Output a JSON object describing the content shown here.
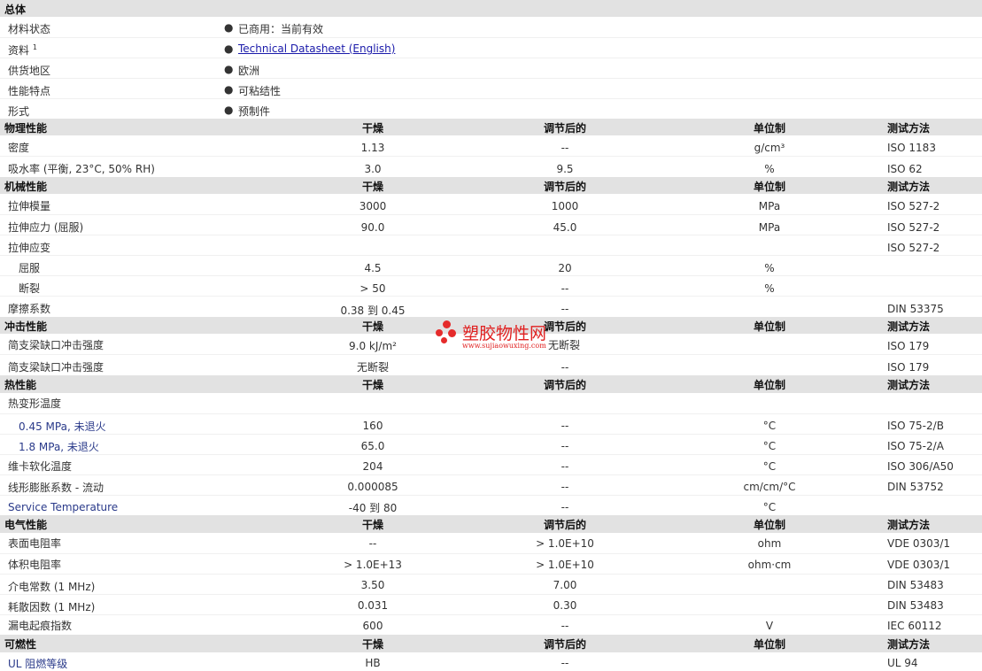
{
  "general": {
    "title": "总体",
    "rows": [
      {
        "label": "材料状态",
        "value": "已商用：当前有效"
      },
      {
        "label": "资料",
        "sup": "1",
        "value": "Technical Datasheet (English)"
      },
      {
        "label": "供货地区",
        "value": "欧洲"
      },
      {
        "label": "性能特点",
        "value": "可粘结性"
      },
      {
        "label": "形式",
        "value": "预制件"
      }
    ]
  },
  "columns": {
    "dry": "干燥",
    "cond": "调节后的",
    "unit": "单位制",
    "method": "测试方法"
  },
  "physical": {
    "title": "物理性能",
    "rows": [
      {
        "label": "密度",
        "dry": "1.13",
        "cond": "--",
        "unit": "g/cm³",
        "method": "ISO 1183"
      },
      {
        "label": "吸水率 (平衡, 23°C, 50% RH)",
        "dry": "3.0",
        "cond": "9.5",
        "unit": "%",
        "method": "ISO 62"
      }
    ]
  },
  "mechanical": {
    "title": "机械性能",
    "rows": [
      {
        "label": "拉伸模量",
        "dry": "3000",
        "cond": "1000",
        "unit": "MPa",
        "method": "ISO 527-2"
      },
      {
        "label": "拉伸应力 (屈服)",
        "dry": "90.0",
        "cond": "45.0",
        "unit": "MPa",
        "method": "ISO 527-2"
      },
      {
        "label": "拉伸应变",
        "dry": "",
        "cond": "",
        "unit": "",
        "method": "ISO 527-2"
      },
      {
        "label": "屈服",
        "dry": "4.5",
        "cond": "20",
        "unit": "%",
        "method": ""
      },
      {
        "label": "断裂",
        "dry": "> 50",
        "cond": "--",
        "unit": "%",
        "method": ""
      },
      {
        "label": "摩擦系数",
        "dry": "0.38 到  0.45",
        "cond": "--",
        "unit": "",
        "method": "DIN 53375"
      }
    ]
  },
  "impact": {
    "title": "冲击性能",
    "rows": [
      {
        "label": "简支梁缺口冲击强度",
        "dry": "9.0 kJ/m²",
        "cond": "无断裂",
        "unit": "",
        "method": "ISO 179"
      },
      {
        "label": "简支梁缺口冲击强度",
        "dry": "无断裂",
        "cond": "--",
        "unit": "",
        "method": "ISO 179"
      }
    ]
  },
  "thermal": {
    "title": "热性能",
    "rows": [
      {
        "label": "热变形温度",
        "dry": "",
        "cond": "",
        "unit": "",
        "method": ""
      },
      {
        "label": "0.45 MPa, 未退火",
        "dry": "160",
        "cond": "--",
        "unit": "°C",
        "method": "ISO 75-2/B"
      },
      {
        "label": "1.8 MPa, 未退火",
        "dry": "65.0",
        "cond": "--",
        "unit": "°C",
        "method": "ISO 75-2/A"
      },
      {
        "label": "维卡软化温度",
        "dry": "204",
        "cond": "--",
        "unit": "°C",
        "method": "ISO 306/A50"
      },
      {
        "label": "线形膨胀系数  - 流动",
        "dry": "0.000085",
        "cond": "--",
        "unit": "cm/cm/°C",
        "method": "DIN 53752"
      },
      {
        "label": "Service Temperature",
        "dry": "-40 到  80",
        "cond": "--",
        "unit": "°C",
        "method": ""
      }
    ]
  },
  "electrical": {
    "title": "电气性能",
    "rows": [
      {
        "label": "表面电阻率",
        "dry": "--",
        "cond": "> 1.0E+10",
        "unit": "ohm",
        "method": "VDE 0303/1"
      },
      {
        "label": "体积电阻率",
        "dry": "> 1.0E+13",
        "cond": "> 1.0E+10",
        "unit": "ohm·cm",
        "method": "VDE 0303/1"
      },
      {
        "label": "介电常数 (1 MHz)",
        "dry": "3.50",
        "cond": "7.00",
        "unit": "",
        "method": "DIN 53483"
      },
      {
        "label": "耗散因数 (1 MHz)",
        "dry": "0.031",
        "cond": "0.30",
        "unit": "",
        "method": "DIN 53483"
      },
      {
        "label": "漏电起痕指数",
        "dry": "600",
        "cond": "--",
        "unit": "V",
        "method": "IEC 60112"
      }
    ]
  },
  "flammability": {
    "title": "可燃性",
    "rows": [
      {
        "label": "UL 阻燃等级",
        "dry": "HB",
        "cond": "--",
        "unit": "",
        "method": "UL 94"
      }
    ]
  },
  "watermark": {
    "title": "塑胶物性网",
    "url": "www.sujiaowuxing.com"
  },
  "colors": {
    "header_bg": "#e2e2e2",
    "link": "#1a1aaa",
    "watermark": "#e52b2b"
  }
}
